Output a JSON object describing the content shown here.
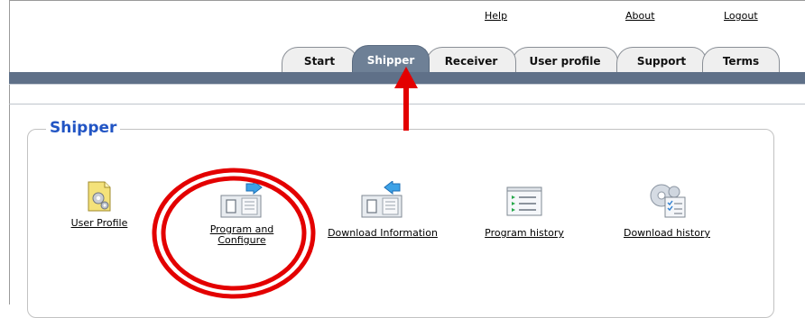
{
  "top_links": {
    "help": "Help",
    "about": "About",
    "logout": "Logout"
  },
  "tabs": [
    {
      "label": "Start"
    },
    {
      "label": "Shipper",
      "active": true
    },
    {
      "label": "Receiver"
    },
    {
      "label": "User profile"
    },
    {
      "label": "Support"
    },
    {
      "label": "Terms"
    }
  ],
  "panel": {
    "title": "Shipper"
  },
  "items": [
    {
      "label": "User Profile",
      "icon": "user-profile-icon"
    },
    {
      "label": "Program and Configure",
      "line1": "Program and",
      "line2": "Configure",
      "icon": "program-configure-icon"
    },
    {
      "label": "Download Information",
      "icon": "download-information-icon"
    },
    {
      "label": "Program history",
      "icon": "program-history-icon"
    },
    {
      "label": "Download history",
      "icon": "download-history-icon"
    }
  ],
  "colors": {
    "accent_blue": "#2255c4",
    "tab_bar": "#5f7088",
    "annotation_red": "#e30000"
  }
}
